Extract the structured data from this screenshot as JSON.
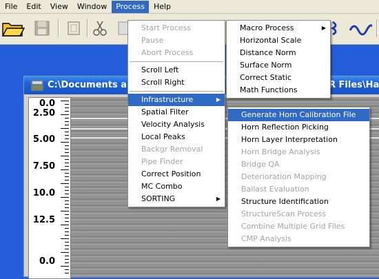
{
  "menubar": {
    "items": [
      {
        "label": "File"
      },
      {
        "label": "Edit"
      },
      {
        "label": "View"
      },
      {
        "label": "Window"
      },
      {
        "label": "Process",
        "active": true
      },
      {
        "label": "Help"
      }
    ]
  },
  "toolbar": {
    "icons": [
      "open-folder-icon",
      "save-icon",
      "new-icon",
      "cut-icon",
      "paste-icon",
      "process-icon",
      "wave-icon"
    ]
  },
  "document": {
    "title": "C:\\Documents a",
    "title_tail": "R Files\\Ha",
    "depth_labels": [
      "0.0",
      "2.50",
      "5.00",
      "7.50",
      "10.0",
      "12.5",
      "0.0"
    ]
  },
  "process_menu": {
    "items": [
      {
        "label": "Start Process",
        "disabled": true
      },
      {
        "label": "Pause",
        "disabled": true
      },
      {
        "label": "Abort Process",
        "disabled": true
      },
      {
        "separator": true
      },
      {
        "label": "Scroll Left"
      },
      {
        "label": "Scroll Right"
      },
      {
        "separator": true
      },
      {
        "label": "Infrastructure",
        "highlighted": true,
        "submenu": true
      },
      {
        "label": "Spatial Filter"
      },
      {
        "label": "Velocity Analysis"
      },
      {
        "label": "Local Peaks"
      },
      {
        "label": "Backgr Removal",
        "disabled": true
      },
      {
        "label": "Pipe Finder",
        "disabled": true
      },
      {
        "label": "Correct Position"
      },
      {
        "label": "MC Combo"
      },
      {
        "label": "SORTING",
        "submenu": true
      }
    ]
  },
  "macro_menu": {
    "items": [
      {
        "label": "Macro Process",
        "submenu": true
      },
      {
        "label": "Horizontal Scale"
      },
      {
        "label": "Distance Norm"
      },
      {
        "label": "Surface Norm"
      },
      {
        "label": "Correct Static"
      },
      {
        "label": "Math Functions"
      }
    ]
  },
  "infrastructure_menu": {
    "items": [
      {
        "label": "Generate Horn Calibration File",
        "highlighted": true
      },
      {
        "label": "Horn Reflection Picking"
      },
      {
        "label": "Horn Layer Interpretation"
      },
      {
        "label": "Horn Bridge Analysis",
        "disabled": true
      },
      {
        "label": "Bridge QA",
        "disabled": true
      },
      {
        "label": "Deterioration Mapping",
        "disabled": true
      },
      {
        "label": "Ballast Evaluation",
        "disabled": true
      },
      {
        "label": "Structure Identification"
      },
      {
        "label": "StructureScan Process",
        "disabled": true
      },
      {
        "label": "Combine Multiple Grid Files",
        "disabled": true
      },
      {
        "label": "CMP Analysis",
        "disabled": true
      }
    ]
  },
  "colors": {
    "menu_highlight": "#316ac5",
    "desktop": "#245edb",
    "chrome": "#ece9d8",
    "disabled_text": "#a3a3a3"
  }
}
